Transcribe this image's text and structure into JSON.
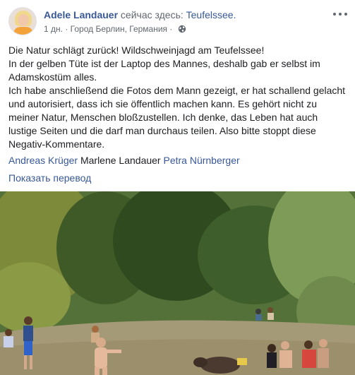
{
  "post": {
    "author": "Adele Landauer",
    "activity": "сейчас здесь:",
    "place": "Teufelssee.",
    "time": "1 дн.",
    "separator": " · ",
    "location": "Город Берлин, Германия",
    "separator2": " · ",
    "privacy_icon": "globe-icon",
    "menu_icon": "more-options-icon",
    "text_lines": [
      "Die Natur schlägt zurück! Wildschweinjagd am Teufelssee!",
      "In der gelben Tüte ist der Laptop des Mannes, deshalb gab er selbst im Adamskostüm alles.",
      "Ich habe anschließend die Fotos dem Mann gezeigt, er hat schallend gelacht und autorisiert, dass ich sie öffentlich machen kann. Es gehört nicht zu meiner Natur, Menschen bloßzustellen. Ich denke, das Leben hat auch lustige Seiten und die darf man durchaus teilen. Also bitte stoppt diese Negativ-Kommentare."
    ],
    "tags": {
      "tag1": "Andreas Krüger",
      "tag2": "Marlene Landauer",
      "tag3": "Petra Nürnberger"
    },
    "translate_link": "Показать перевод"
  },
  "colors": {
    "link": "#385898",
    "text": "#1c1e21",
    "meta": "#616770"
  }
}
